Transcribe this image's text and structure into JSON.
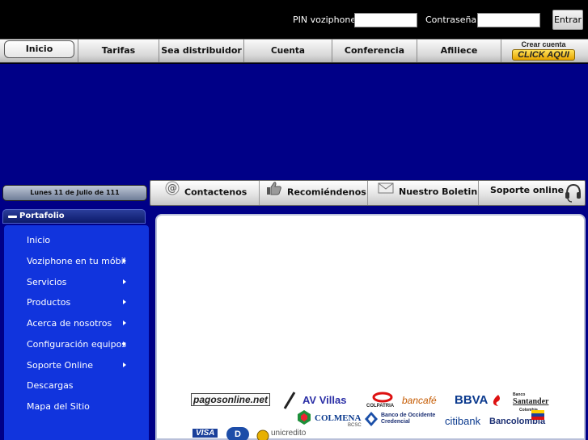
{
  "login": {
    "pin_label": "PIN voziphone:",
    "password_label": "Contraseña:",
    "submit_label": "Entrar",
    "pin_value": "",
    "password_value": ""
  },
  "main_nav": {
    "items": [
      {
        "label": "Inicio"
      },
      {
        "label": "Tarifas"
      },
      {
        "label": "Sea distribuidor"
      },
      {
        "label": "Cuenta distribuidor"
      },
      {
        "label": "Conferencia"
      },
      {
        "label": "Afiliece"
      }
    ],
    "cta_top": "Crear cuenta",
    "cta_bottom": "CLICK AQUI"
  },
  "sub_nav": {
    "date": "Lunes 11 de Julio de 111",
    "items": [
      {
        "label": "Contactenos",
        "icon": "at-icon"
      },
      {
        "label": "Recomiéndenos",
        "icon": "thumbs-up-icon"
      },
      {
        "label": "Nuestro Boletin",
        "icon": "envelope-icon"
      },
      {
        "label": "Soporte online",
        "icon": "headset-icon"
      }
    ]
  },
  "sidebar": {
    "title": "Portafolio",
    "items": [
      {
        "label": "Inicio",
        "has_submenu": false
      },
      {
        "label": "Voziphone en tu móbil",
        "has_submenu": true
      },
      {
        "label": "Servicios",
        "has_submenu": true
      },
      {
        "label": "Productos",
        "has_submenu": true
      },
      {
        "label": "Acerca de nosotros",
        "has_submenu": true
      },
      {
        "label": "Configuración equipos",
        "has_submenu": true
      },
      {
        "label": "Soporte Online",
        "has_submenu": true
      },
      {
        "label": "Descargas",
        "has_submenu": false
      },
      {
        "label": "Mapa del Sitio",
        "has_submenu": false
      }
    ]
  },
  "payment_logos": {
    "pagosonline": "pagosonline.net",
    "avvillas": "AV Villas",
    "colpatria": "COLPATRIA",
    "bancafe": "bancafé",
    "bbva": "BBVA",
    "santander_small": "Banco",
    "santander": "Santander",
    "santander_country": "Colombia",
    "colmena": "COLMENA",
    "colmena_sub": "BCSC",
    "occidente": "Banco de Occidente",
    "occidente_sub": "Credencial",
    "citibank": "citibank",
    "bancolombia": "Bancolombia",
    "visa": "VISA",
    "diners": "D",
    "bottom_partial": "unicredito"
  },
  "colors": {
    "banner_blue": "#000087",
    "menu_blue": "#1134dd",
    "top_black": "#000000"
  }
}
